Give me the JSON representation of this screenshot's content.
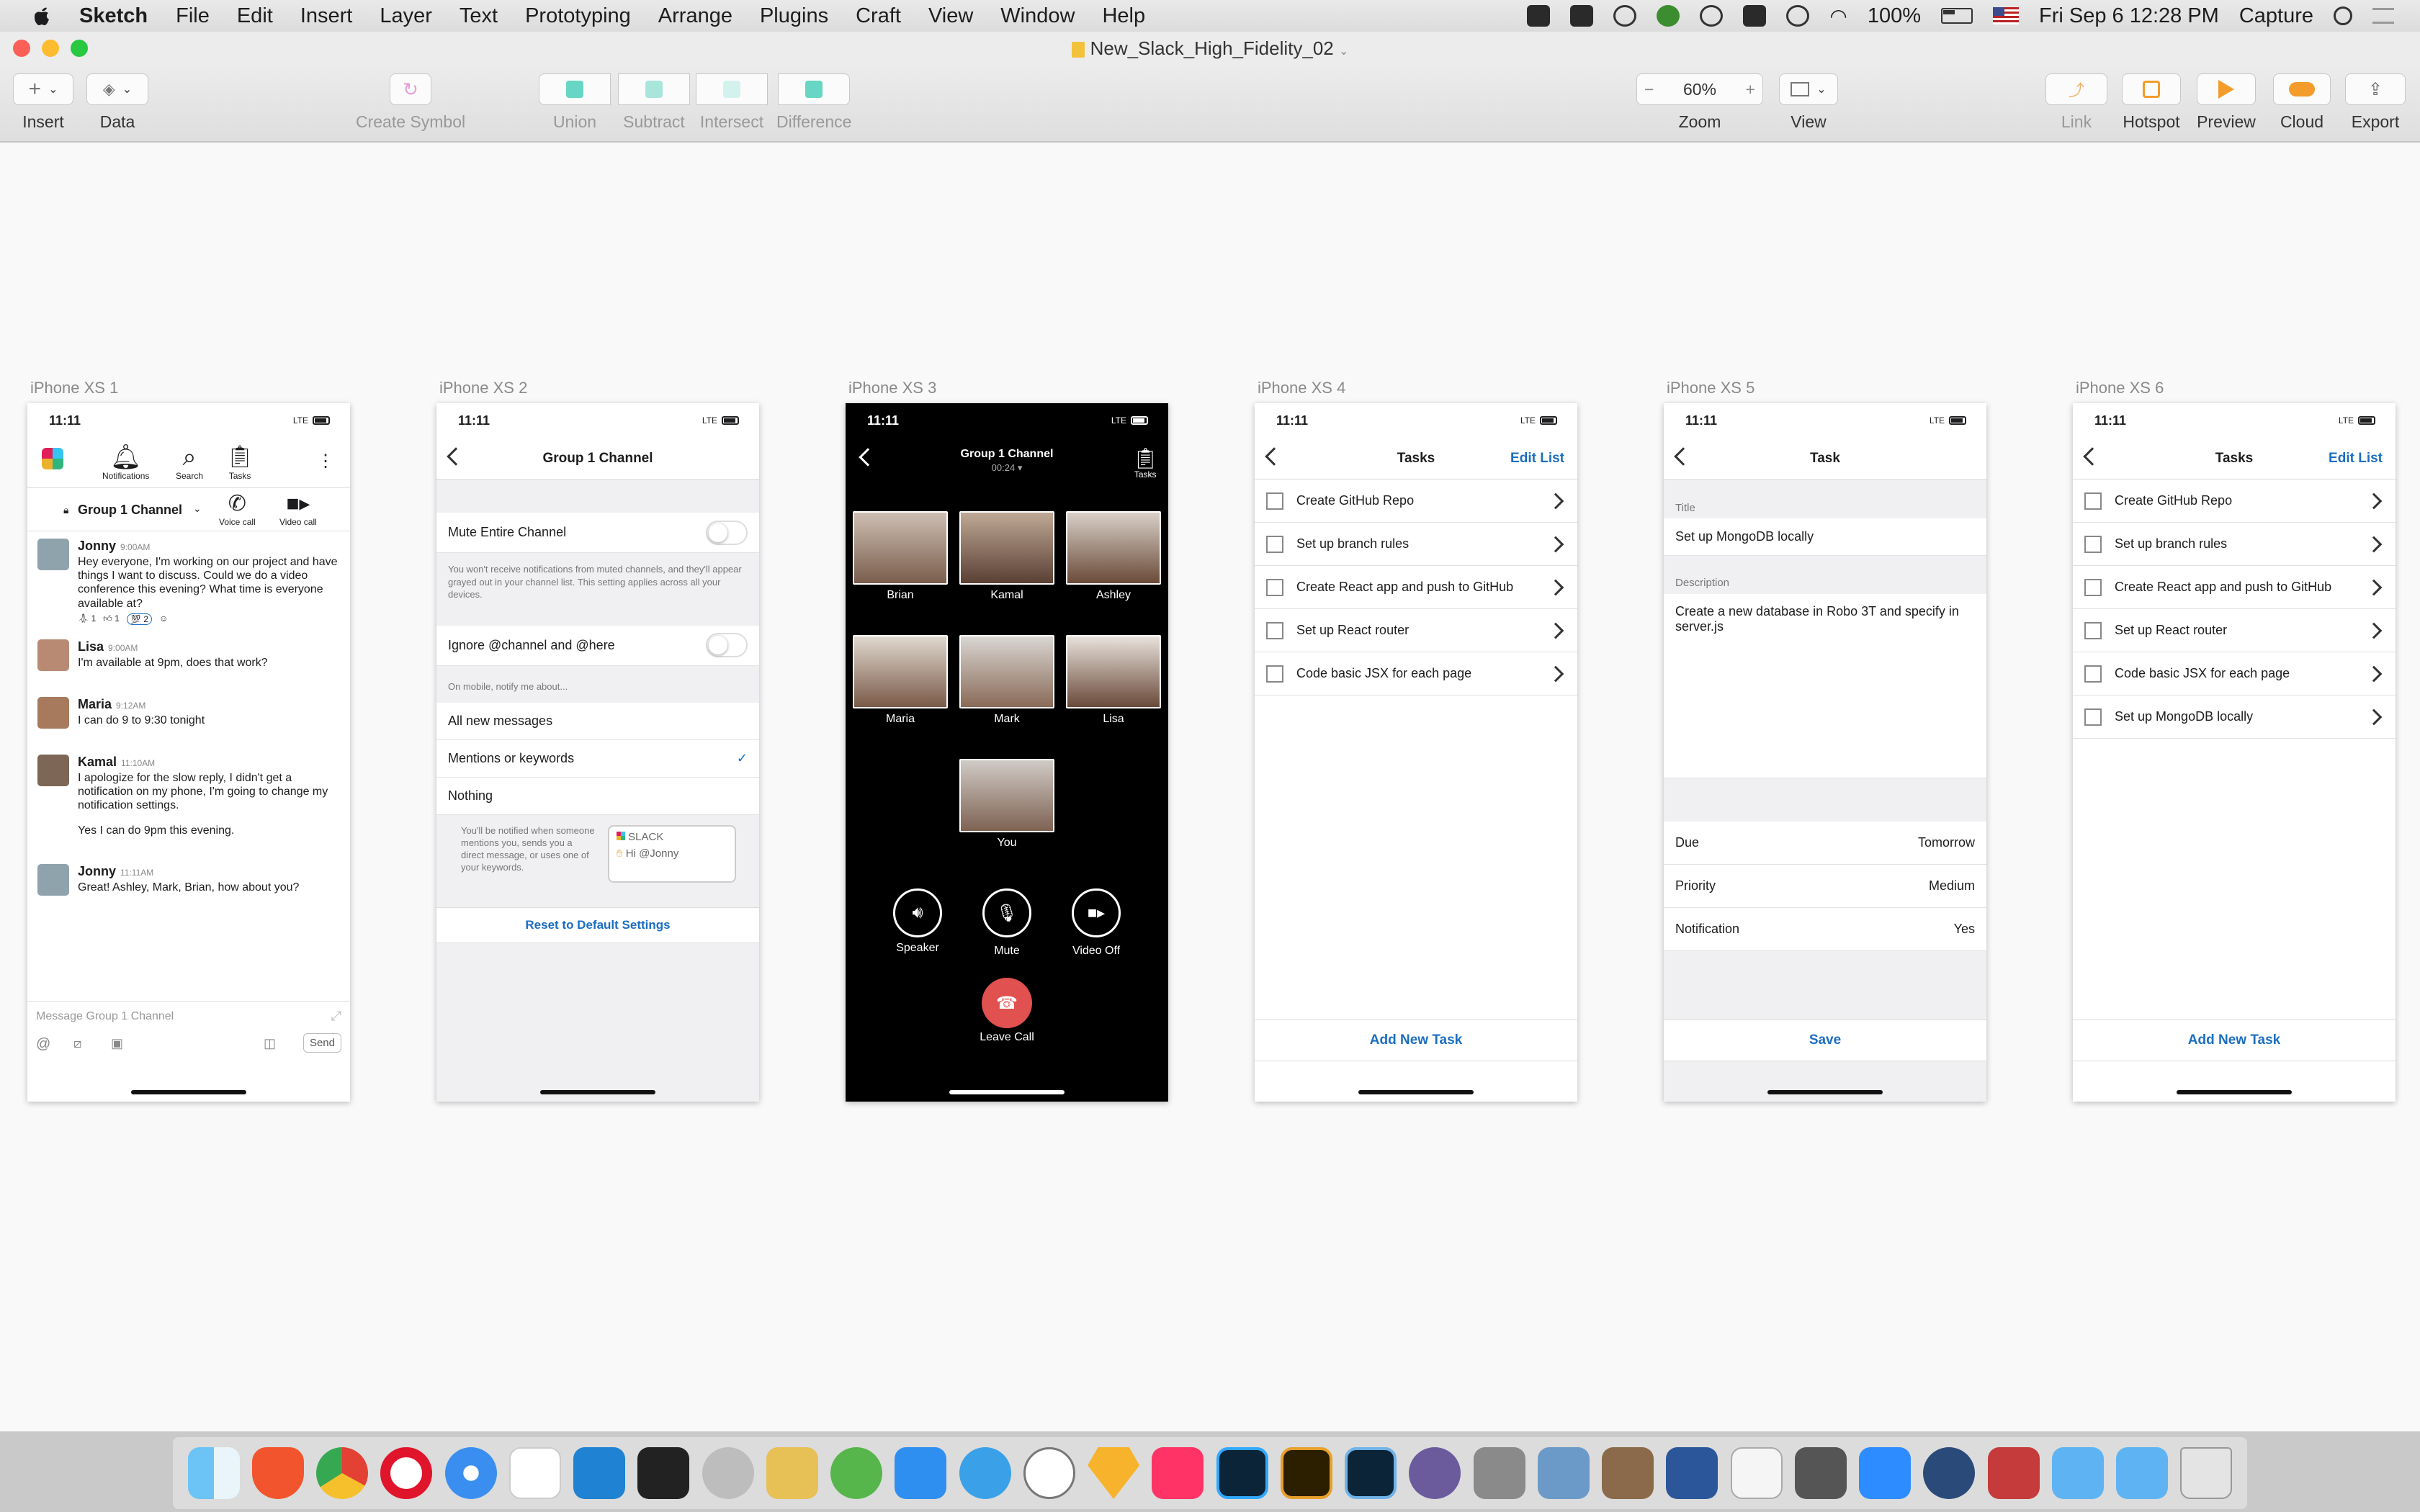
{
  "menubar": {
    "app": "Sketch",
    "items": [
      "File",
      "Edit",
      "Insert",
      "Layer",
      "Text",
      "Prototyping",
      "Arrange",
      "Plugins",
      "Craft",
      "View",
      "Window",
      "Help"
    ],
    "battery": "100%",
    "datetime": "Fri Sep 6  12:28 PM",
    "capture": "Capture"
  },
  "document": {
    "title": "New_Slack_High_Fidelity_02"
  },
  "toolbar": {
    "insert": "Insert",
    "data": "Data",
    "create_symbol": "Create Symbol",
    "union": "Union",
    "subtract": "Subtract",
    "intersect": "Intersect",
    "difference": "Difference",
    "zoom_value": "60%",
    "zoom": "Zoom",
    "view": "View",
    "link": "Link",
    "hotspot": "Hotspot",
    "preview": "Preview",
    "cloud": "Cloud",
    "export": "Export"
  },
  "artboards": [
    "iPhone XS 1",
    "iPhone XS 2",
    "iPhone XS 3",
    "iPhone XS 4",
    "iPhone XS 5",
    "iPhone XS 6"
  ],
  "status_time": "11:11",
  "status_net": "LTE",
  "phone1": {
    "tabs": [
      "Notifications",
      "Search",
      "Tasks"
    ],
    "channel": "Group 1 Channel",
    "voice": "Voice call",
    "video": "Video call",
    "messages": [
      {
        "name": "Jonny",
        "time": "9:00AM",
        "text": "Hey everyone, I'm working on our project and have things I want to discuss.  Could we do a video conference this evening?  What time is everyone available at?"
      },
      {
        "name": "Lisa",
        "time": "9:00AM",
        "text": "I'm available at 9pm, does that work?"
      },
      {
        "name": "Maria",
        "time": "9:12AM",
        "text": "I can do 9 to 9:30 tonight"
      },
      {
        "name": "Kamal",
        "time": "11:10AM",
        "text": "I apologize for the slow reply, I didn't get a notification on my phone, I'm going to change my notification settings."
      },
      {
        "name": "Jonny",
        "time": "11:11AM",
        "text": "Great!  Ashley, Mark, Brian, how about you?"
      }
    ],
    "reaction_counts": [
      "1",
      "1",
      "2"
    ],
    "kamal_extra": "Yes I can do 9pm this evening.",
    "composer": "Message Group 1 Channel",
    "send": "Send"
  },
  "phone2": {
    "title": "Group 1 Channel",
    "mute": "Mute Entire Channel",
    "mute_note": "You won't receive notifications from muted channels, and they'll appear grayed out in your channel list. This setting applies across all your devices.",
    "ignore": "Ignore @channel and @here",
    "notify_header": "On mobile, notify me about...",
    "options": [
      "All new messages",
      "Mentions or keywords",
      "Nothing"
    ],
    "checkmark": "✓",
    "explain": "You'll be notified when someone mentions you, sends you a direct message, or uses one of your keywords.",
    "preview_app": "SLACK",
    "preview_text": "Hi @Jonny",
    "reset": "Reset to Default Settings"
  },
  "phone3": {
    "title": "Group 1 Channel",
    "duration": "00:24",
    "tasks": "Tasks",
    "people": [
      "Brian",
      "Kamal",
      "Ashley",
      "Maria",
      "Mark",
      "Lisa",
      "You"
    ],
    "speaker": "Speaker",
    "mute": "Mute",
    "video_off": "Video Off",
    "leave": "Leave Call"
  },
  "phone4": {
    "title": "Tasks",
    "edit": "Edit List",
    "tasks": [
      "Create GitHub Repo",
      "Set up branch rules",
      "Create React app and push to GitHub",
      "Set up React router",
      "Code basic JSX for each page"
    ],
    "add": "Add New Task"
  },
  "phone5": {
    "title": "Task",
    "title_label": "Title",
    "title_value": "Set up MongoDB locally",
    "desc_label": "Description",
    "desc_value": "Create a new database in Robo 3T and specify in server.js",
    "due_label": "Due",
    "due_value": "Tomorrow",
    "priority_label": "Priority",
    "priority_value": "Medium",
    "notif_label": "Notification",
    "notif_value": "Yes",
    "save": "Save"
  },
  "phone6": {
    "title": "Tasks",
    "edit": "Edit List",
    "tasks": [
      "Create GitHub Repo",
      "Set up branch rules",
      "Create React app and push to GitHub",
      "Set up React router",
      "Code basic JSX for each page",
      "Set up MongoDB locally"
    ],
    "add": "Add New Task"
  },
  "dock": [
    "finder",
    "brave",
    "chrome",
    "opera",
    "safari",
    "slack",
    "vscode",
    "terminal",
    "tableplus",
    "sequel",
    "sourcetree",
    "xcode",
    "markdown",
    "clock",
    "sketch",
    "invision",
    "photoshop",
    "bridge",
    "lightroom",
    "dev-tools",
    "screenshot",
    "preview",
    "photo-booth",
    "word",
    "textedit",
    "calculator",
    "zoom",
    "quicktime",
    "photo-app",
    "applications",
    "downloads",
    "trash"
  ]
}
